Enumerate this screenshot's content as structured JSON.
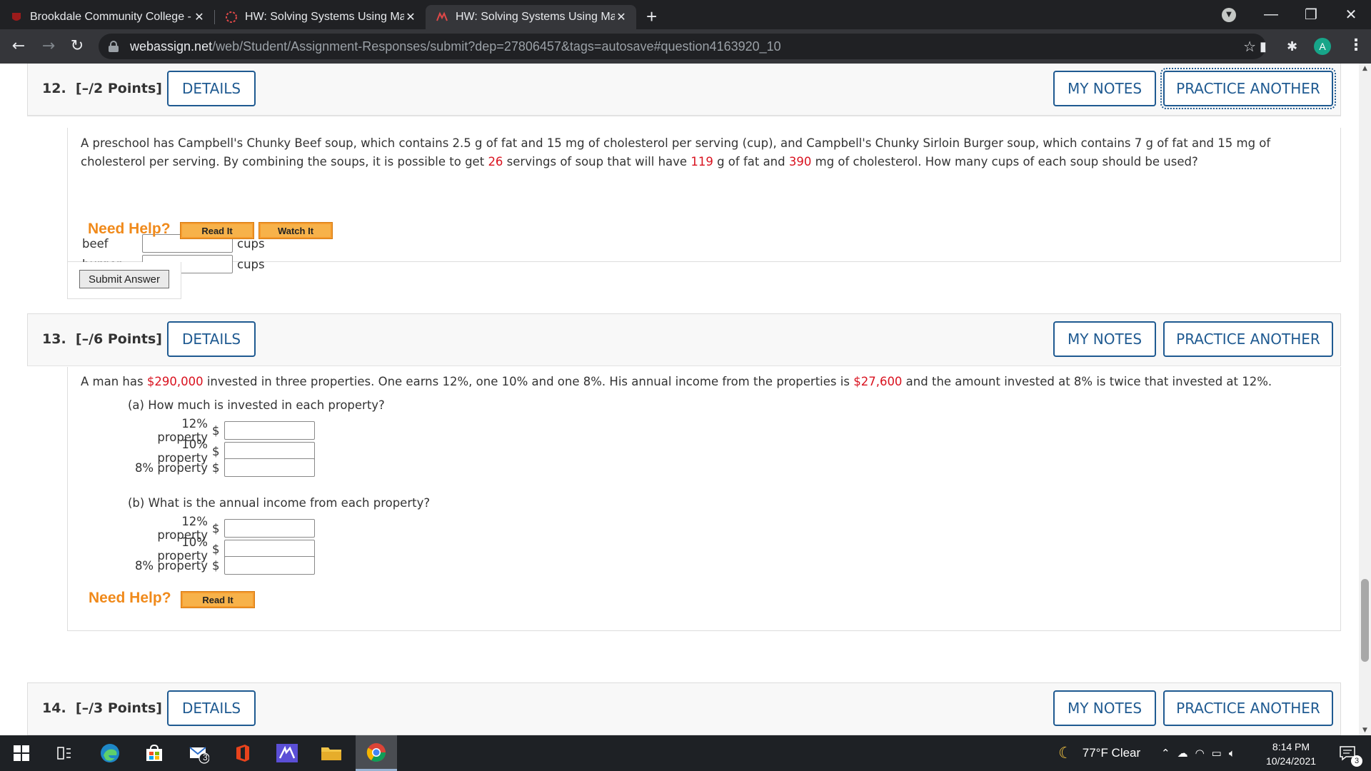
{
  "browser": {
    "tabs": [
      {
        "title": "Brookdale Community College - ",
        "close": "✕"
      },
      {
        "title": "HW: Solving Systems Using Matr",
        "close": "✕"
      },
      {
        "title": "HW: Solving Systems Using Matr",
        "close": "✕"
      }
    ],
    "new_tab": "+",
    "url_domain": "webassign.net",
    "url_path": "/web/Student/Assignment-Responses/submit?dep=27806457&tags=autosave#question4163920_10",
    "profile_initial": "A"
  },
  "common": {
    "details_label": "DETAILS",
    "my_notes_label": "MY NOTES",
    "practice_label": "PRACTICE ANOTHER",
    "need_help": "Need Help?",
    "read_it": "Read It",
    "watch_it": "Watch It",
    "submit_label": "Submit Answer"
  },
  "q12": {
    "number": "12.",
    "points": "[–/2 Points]",
    "t1": "A preschool has Campbell's Chunky Beef soup, which contains 2.5 g of fat and 15 mg of cholesterol per serving (cup), and Campbell's Chunky Sirloin Burger soup, which contains 7 g of fat and 15 mg of",
    "t2a": "cholesterol per serving. By combining the soups, it is possible to get ",
    "v_servings": "26",
    "t2b": " servings of soup that will have ",
    "v_fat": "119",
    "t2c": " g of fat and ",
    "v_chol": "390",
    "t2d": " mg of cholesterol. How many cups of each soup should be used?",
    "rows": [
      {
        "label": "beef",
        "unit": "cups",
        "value": ""
      },
      {
        "label": "burger",
        "unit": "cups",
        "value": ""
      }
    ]
  },
  "q13": {
    "number": "13.",
    "points": "[–/6 Points]",
    "t1a": "A man has ",
    "v_total": "$290,000",
    "t1b": " invested in three properties. One earns 12%, one 10% and one 8%. His annual income from the properties is ",
    "v_income": "$27,600",
    "t1c": " and the amount invested at 8% is twice that invested at 12%.",
    "part_a": "(a) How much is invested in each property?",
    "part_b": "(b) What is the annual income from each property?",
    "a_rows": [
      {
        "label": "12% property",
        "prefix": "$",
        "value": ""
      },
      {
        "label": "10% property",
        "prefix": "$",
        "value": ""
      },
      {
        "label": "8% property",
        "prefix": "$",
        "value": ""
      }
    ],
    "b_rows": [
      {
        "label": "12% property",
        "prefix": "$",
        "value": ""
      },
      {
        "label": "10% property",
        "prefix": "$",
        "value": ""
      },
      {
        "label": "8% property",
        "prefix": "$",
        "value": ""
      }
    ]
  },
  "q14": {
    "number": "14.",
    "points": "[–/3 Points]"
  },
  "taskbar": {
    "mail_badge": "3",
    "weather": "77°F  Clear",
    "time": "8:14 PM",
    "date": "10/24/2021",
    "notif_badge": "3"
  }
}
